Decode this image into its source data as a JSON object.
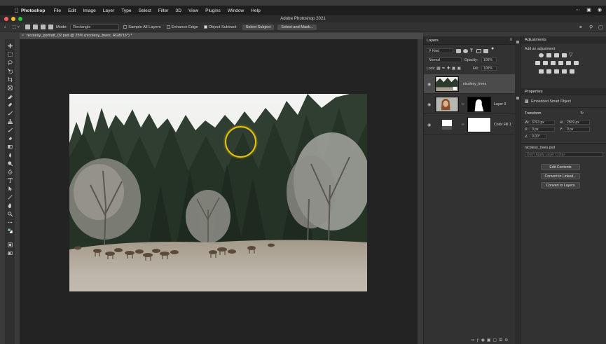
{
  "menubar": {
    "app": "Photoshop",
    "items": [
      "File",
      "Edit",
      "Image",
      "Layer",
      "Type",
      "Select",
      "Filter",
      "3D",
      "View",
      "Plugins",
      "Window",
      "Help"
    ],
    "right_icons": [
      "more-icon",
      "display-icon",
      "control-center-icon"
    ]
  },
  "window": {
    "title": "Adobe Photoshop 2021",
    "traffic_colors": [
      "#ff5f57",
      "#febc2e",
      "#28c840"
    ]
  },
  "options": {
    "mode_label": "Mode:",
    "mode_value": "Rectangle",
    "sample_all_layers": "Sample All Layers",
    "enhance_edge": "Enhance Edge",
    "object_subtract": "Object Subtract",
    "select_subject": "Select Subject",
    "select_and_mask": "Select and Mask..."
  },
  "document": {
    "tab_title": "nicolesy_portrait_02.psd @ 25% (nicolesy_trees, RGB/16*) *"
  },
  "layers_panel": {
    "tab": "Layers",
    "filter_kind": "Kind",
    "blend_mode": "Normal",
    "opacity_label": "Opacity:",
    "opacity_value": "100%",
    "lock_label": "Lock:",
    "fill_label": "Fill:",
    "fill_value": "100%",
    "layers": [
      {
        "name": "nicolesy_trees",
        "selected": true
      },
      {
        "name": "Layer 0",
        "selected": false
      },
      {
        "name": "Color Fill 1",
        "selected": false
      }
    ]
  },
  "adjustments_panel": {
    "tab": "Adjustments",
    "subtitle": "Add an adjustment"
  },
  "properties_panel": {
    "tab": "Properties",
    "object_type": "Embedded Smart Object",
    "transform_label": "Transform",
    "w_label": "W:",
    "w_value": "3763 px",
    "h_label": "H:",
    "h_value": "2509 px",
    "x_label": "X:",
    "x_value": "0 px",
    "y_label": "Y:",
    "y_value": "0 px",
    "angle_value": "0.00°",
    "file_name": "nicolesy_trees.psd",
    "comps_placeholder": "Don't Apply Layer Comp",
    "edit_contents": "Edit Contents",
    "convert_linked": "Convert to Linked...",
    "convert_layers": "Convert to Layers"
  },
  "colors": {
    "accent": "#e8c20a",
    "ui_dark": "#323232",
    "canvas_bg": "#232323"
  }
}
